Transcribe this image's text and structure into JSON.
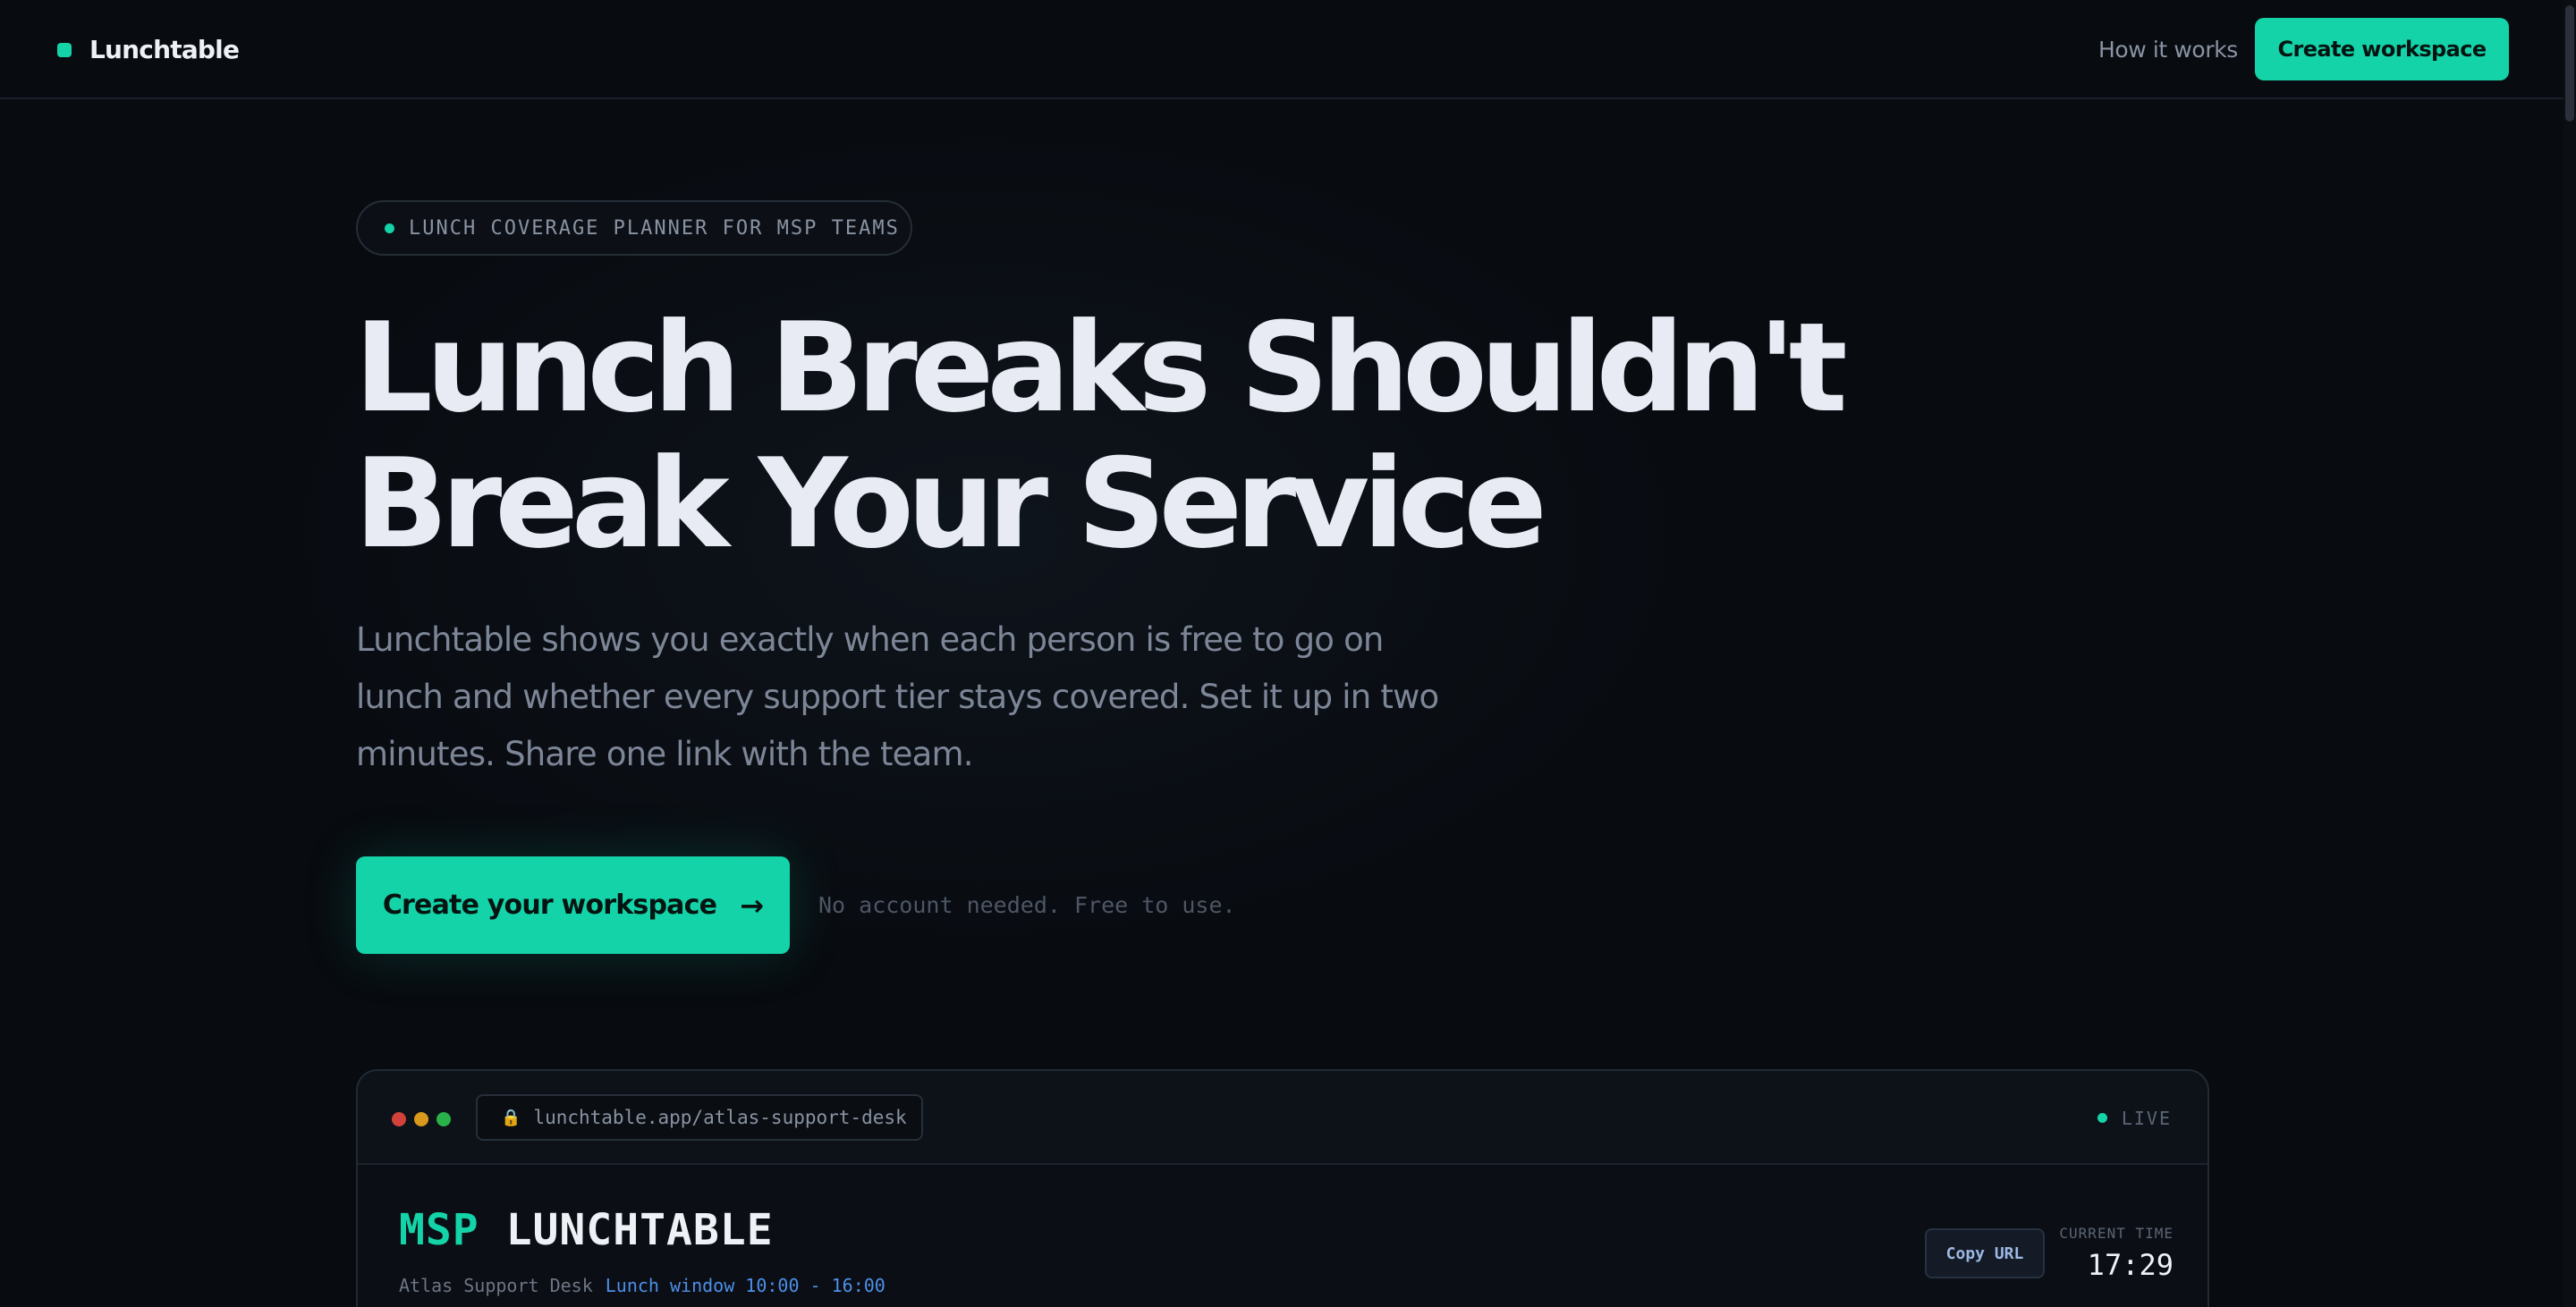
{
  "nav": {
    "brand": "Lunchtable",
    "link_how": "How it works",
    "cta": "Create workspace"
  },
  "hero": {
    "badge": "LUNCH COVERAGE PLANNER FOR MSP TEAMS",
    "headline_line1": "Lunch Breaks Shouldn't",
    "headline_line2": "Break Your Service",
    "subcopy": "Lunchtable shows you exactly when each person is free to go on lunch and whether every support tier stays covered. Set it up in two minutes. Share one link with the team.",
    "cta": "Create your workspace",
    "cta_arrow": "→",
    "note": "No account needed. Free to use."
  },
  "preview": {
    "url": "lunchtable.app/atlas-support-desk",
    "lock_glyph": "🔒",
    "live": "LIVE",
    "title_accent": "MSP",
    "title_rest": "LUNCHTABLE",
    "team": "Atlas Support Desk",
    "window": "Lunch window 10:00 - 16:00",
    "copy_url": "Copy URL",
    "time_label": "CURRENT TIME",
    "time_value": "17:29"
  },
  "colors": {
    "accent": "#14d3a8",
    "background": "#080b10",
    "link_blue": "#4d8fe8"
  },
  "icons": {
    "lock": "lock-icon",
    "arrow": "arrow-right-icon"
  }
}
